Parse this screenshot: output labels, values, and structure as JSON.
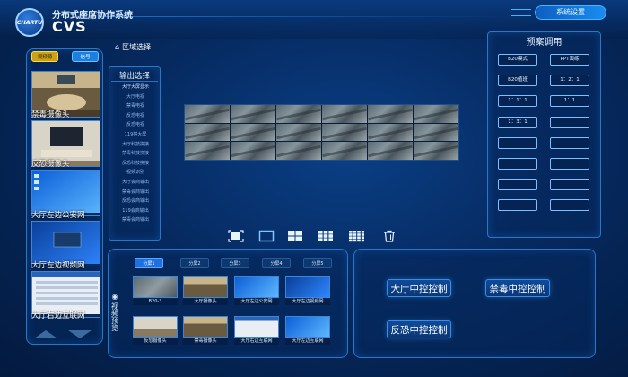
{
  "header": {
    "logo_text": "CHARTU",
    "subtitle": "分布式座席协作系统",
    "title": "CVS",
    "right_button": "系统设置"
  },
  "left": {
    "tabs": [
      "视频源",
      "信号"
    ],
    "cameras": [
      {
        "label": "禁毒摄像头"
      },
      {
        "label": "反恐摄像头"
      },
      {
        "label": "大厅左边公安网"
      },
      {
        "label": "大厅左边视频网"
      },
      {
        "label": "大厅右边互联网"
      }
    ]
  },
  "output_select": {
    "region_label": "区域选择",
    "title": "输出选择",
    "items": [
      "大厅大屏显示",
      "大厅电视",
      "禁毒电视",
      "反恐电视",
      "反恐电视",
      "119拼大屏",
      "大厅科技拼接",
      "禁毒科技拼接",
      "反恐科技拼接",
      "视频识别",
      "大厅会商输出",
      "禁毒会商输出",
      "反恐会商输出",
      "119会商输出",
      "禁毒会商输出"
    ]
  },
  "layouts": [
    "fullscreen-icon",
    "single-layout-icon",
    "quad-layout-icon",
    "nine-layout-icon",
    "sixteen-layout-icon",
    "delete-icon"
  ],
  "bottom": {
    "vertical_label": "视频预览",
    "split_tabs": [
      "分屏1",
      "分屏2",
      "分屏3",
      "分屏4",
      "分屏5"
    ],
    "thumbnails": [
      "B20-3",
      "大厅摄像头",
      "大厅左边公安网",
      "大厅左边视频网",
      "反恐摄像头",
      "禁毒摄像头",
      "大厅右边互联网",
      "大厅左边互联网"
    ]
  },
  "controls": {
    "buttons": [
      "大厅中控控制",
      "禁毒中控控制",
      "反恐中控控制"
    ]
  },
  "preset": {
    "title": "预案调用",
    "buttons": [
      "B20模式",
      "PPT演练",
      "B20值班",
      "1：2：1",
      "1：1：1",
      "1：1",
      "1：3：1",
      "",
      "",
      "",
      "",
      "",
      "",
      "",
      "",
      ""
    ]
  },
  "colors": {
    "accent": "#1f6fe0",
    "panel_border": "#2a76c8",
    "background": "#062a60"
  }
}
